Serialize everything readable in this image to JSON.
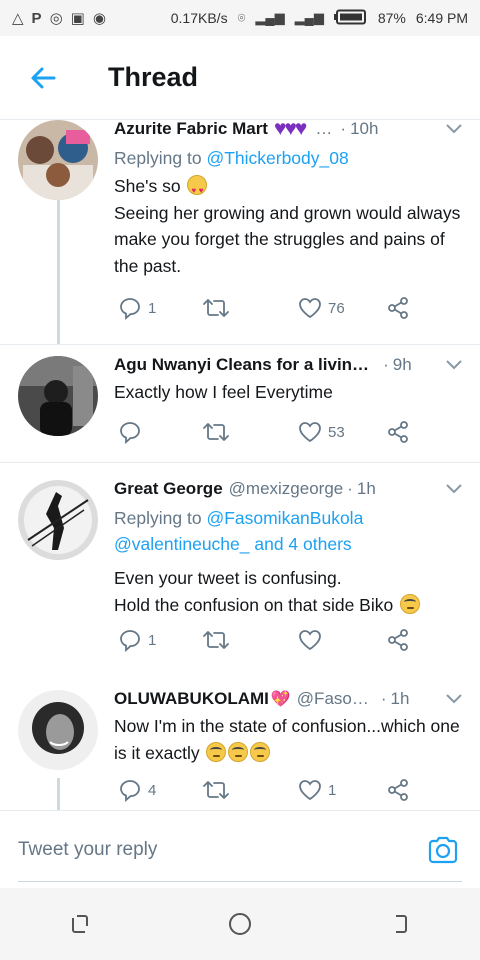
{
  "status_bar": {
    "left_icons": [
      "warning-triangle",
      "parking",
      "whatsapp",
      "image",
      "radio"
    ],
    "speed": "0.17KB/s",
    "battery": "87%",
    "time": "6:49 PM"
  },
  "header": {
    "title": "Thread"
  },
  "colors": {
    "accent": "#1da1f2",
    "secondary_text": "#657786",
    "purple_heart": "#7b2fbe"
  },
  "tweets": [
    {
      "name": "Azurite Fabric Mart",
      "name_suffix": "…",
      "handle": "",
      "time": "10h",
      "replying_label": "Replying to",
      "replying_to": "@Thickerbody_08",
      "line1": "She's so",
      "line2": "Seeing her growing and grown would always make you forget the struggles and pains of the past.",
      "replies": "1",
      "retweets": "",
      "likes": "76"
    },
    {
      "name": "Agu Nwanyi Cleans for a livin…",
      "handle": "",
      "time": "9h",
      "line1": "Exactly how I feel Everytime",
      "replies": "",
      "retweets": "",
      "likes": "53"
    },
    {
      "name": "Great George",
      "handle": "@mexizgeorge",
      "time": "1h",
      "replying_label": "Replying to",
      "replying_to": "@FasomikanBukola",
      "replying_more": "@valentineuche_ and 4 others",
      "line1": "Even your tweet is confusing.",
      "line2": "Hold the confusion on that side Biko",
      "replies": "1",
      "retweets": "",
      "likes": ""
    },
    {
      "name": "OLUWABUKOLAMI",
      "handle": "@Faso…",
      "time": "1h",
      "line1": "Now I'm in the state of confusion...which one is it exactly",
      "replies": "4",
      "retweets": "",
      "likes": "1"
    }
  ],
  "composer": {
    "placeholder": "Tweet your reply"
  }
}
